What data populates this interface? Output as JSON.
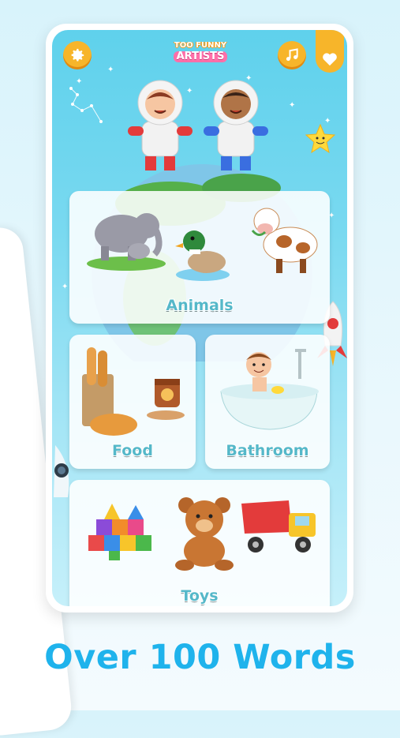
{
  "app": {
    "logo_line1": "TOO FUNNY",
    "logo_line2": "ARTISTS"
  },
  "topbar": {
    "settings_icon": "gear-icon",
    "music_icon": "music-note-icon",
    "favorite_icon": "heart-icon"
  },
  "categories": [
    {
      "label": "Animals"
    },
    {
      "label": "Food"
    },
    {
      "label": "Bathroom"
    },
    {
      "label": "Toys"
    }
  ],
  "caption": "Over 100 Words",
  "colors": {
    "accent": "#f7b52a",
    "label": "#55b8c9",
    "caption": "#1fb3ec",
    "sky": "#5fd1ec"
  }
}
